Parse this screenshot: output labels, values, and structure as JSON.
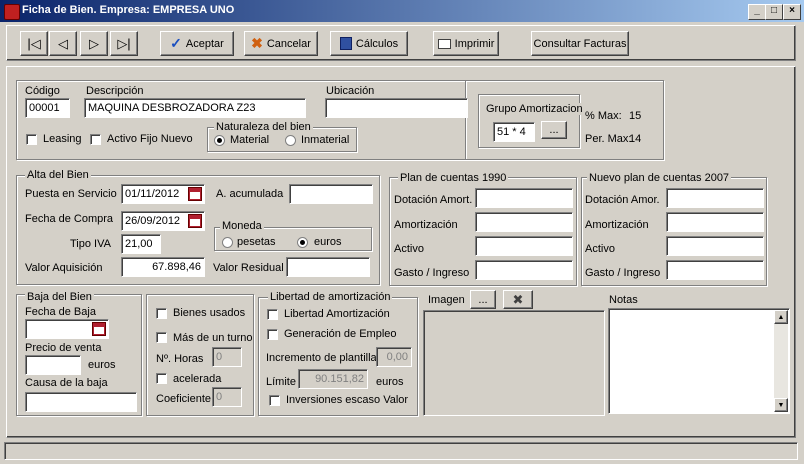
{
  "window": {
    "title": "Ficha de  Bien. Empresa:  EMPRESA UNO",
    "min": "_",
    "max": "□",
    "close": "×"
  },
  "toolbar": {
    "aceptar": "Aceptar",
    "cancelar": "Cancelar",
    "calculos": "Cálculos",
    "imprimir": "Imprimir",
    "consultar": "Consultar Facturas"
  },
  "header": {
    "codigo_label": "Código",
    "codigo_value": "00001",
    "descripcion_label": "Descripción",
    "descripcion_value": "MAQUINA DESBROZADORA Z23",
    "ubicacion_label": "Ubicación",
    "ubicacion_value": "",
    "leasing": "Leasing",
    "activo_fijo": "Activo Fijo Nuevo",
    "naturaleza": {
      "title": "Naturaleza del bien",
      "material": "Material",
      "inmaterial": "Inmaterial",
      "selected": "Material"
    },
    "grupo": {
      "title": "Grupo Amortizacion",
      "value": "51 * 4",
      "browse": "...",
      "pmax_label": "% Max:",
      "pmax_value": "15",
      "permax_label": "Per. Max:",
      "permax_value": "14"
    }
  },
  "alta": {
    "title": "Alta del Bien",
    "puesta_label": "Puesta en Servicio",
    "puesta_value": "01/11/2012",
    "compra_label": "Fecha de Compra",
    "compra_value": "26/09/2012",
    "iva_label": "Tipo IVA",
    "iva_value": "21,00",
    "valor_label": "Valor Aquisición",
    "valor_value": "67.898,46",
    "acumulada_label": "A. acumulada",
    "acumulada_value": "",
    "residual_label": "Valor Residual",
    "residual_value": "",
    "moneda": {
      "title": "Moneda",
      "pesetas": "pesetas",
      "euros": "euros",
      "selected": "euros"
    }
  },
  "plan1990": {
    "title": "Plan de cuentas 1990",
    "dotacion": "Dotación Amort.",
    "amortizacion": "Amortización",
    "activo": "Activo",
    "gasto": "Gasto / Ingreso"
  },
  "plan2007": {
    "title": "Nuevo plan de cuentas 2007",
    "dotacion": "Dotación Amor.",
    "amortizacion": "Amortización",
    "activo": "Activo",
    "gasto": "Gasto / Ingreso"
  },
  "baja": {
    "title": "Baja del Bien",
    "fecha_label": "Fecha de Baja",
    "precio_label": "Precio de venta",
    "euros": "euros",
    "causa_label": "Causa de la baja"
  },
  "bienes": {
    "usados": "Bienes usados",
    "turno": "Más de un turno",
    "horas_label": "Nº. Horas",
    "horas_value": "0",
    "acelerada": "acelerada",
    "coef_label": "Coeficiente",
    "coef_value": "0"
  },
  "libertad": {
    "title": "Libertad de amortización",
    "libertad_chk": "Libertad Amortización",
    "empleo_chk": "Generación de Empleo",
    "incremento_label": "Incremento de plantilla",
    "incremento_value": "0,00",
    "limite_label": "Límite",
    "limite_value": "90.151,82",
    "limite_unit": "euros",
    "inversiones_chk": "Inversiones escaso Valor"
  },
  "imagen": {
    "label": "Imagen",
    "browse": "...",
    "clear": "✖"
  },
  "notas": {
    "label": "Notas",
    "up": "▲",
    "down": "▼"
  }
}
